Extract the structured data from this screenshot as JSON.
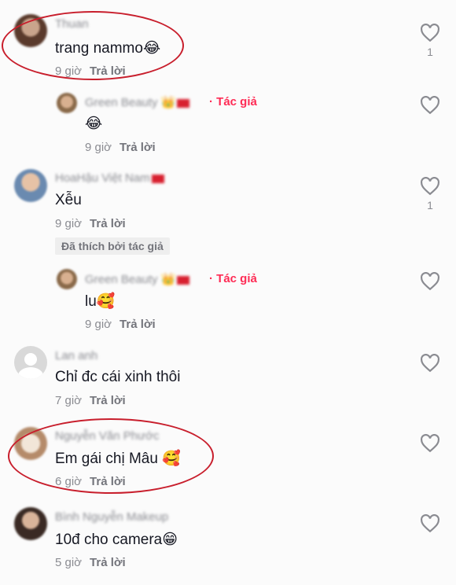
{
  "labels": {
    "reply": "Trả lời",
    "author": "· Tác giả",
    "liked_by_author": "Đã thích bởi tác giả"
  },
  "comments": [
    {
      "username": "Thuan",
      "text": "trang nammo",
      "emoji": "😂",
      "time": "9 giờ",
      "likes": "1"
    },
    {
      "username": "Green Beauty",
      "text": "",
      "emoji": "😂",
      "time": "9 giờ"
    },
    {
      "username": "HoaHậu Việt Nam",
      "text": "Xễu",
      "emoji": "",
      "time": "9 giờ",
      "likes": "1"
    },
    {
      "username": "Green Beauty",
      "text": "lu",
      "emoji": "🥰",
      "time": "9 giờ"
    },
    {
      "username": "Lan anh",
      "text": "Chỉ đc cái xinh thôi",
      "emoji": "",
      "time": "7 giờ"
    },
    {
      "username": "Nguyễn Văn Phước",
      "text": "Em gái chị Mâu ",
      "emoji": "🥰",
      "time": "6 giờ"
    },
    {
      "username": "Bình Nguyễn Makeup",
      "text": "10đ cho camera",
      "emoji": "😁",
      "time": "5 giờ"
    }
  ],
  "colors": {
    "author_tag": "#fe2c55",
    "highlight_circle": "#c81e2c"
  }
}
